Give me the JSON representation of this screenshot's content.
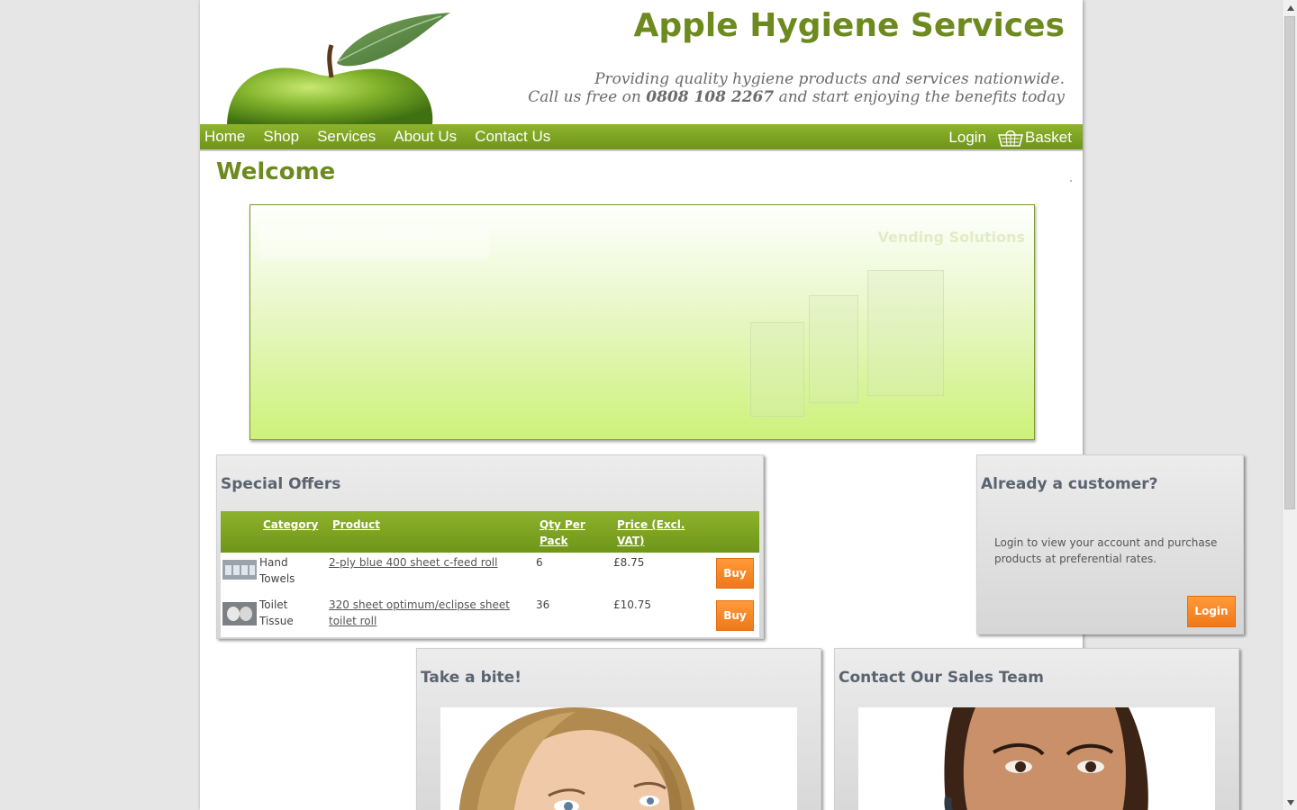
{
  "header": {
    "title": "Apple Hygiene Services",
    "tagline_line1": "Providing quality hygiene products and services nationwide.",
    "tagline_pre": "Call us free on ",
    "phone": "0808 108 2267",
    "tagline_post": " and start enjoying the benefits today"
  },
  "nav": {
    "items": [
      "Home",
      "Shop",
      "Services",
      "About Us",
      "Contact Us"
    ],
    "login": "Login",
    "basket": "Basket"
  },
  "welcome": "Welcome",
  "banner": {
    "heading": "Vending Solutions"
  },
  "offers": {
    "title": "Special Offers",
    "columns": [
      "Category",
      "Product",
      "Qty Per Pack",
      "Price (Excl. VAT)"
    ],
    "rows": [
      {
        "category": "Hand Towels",
        "product": "2-ply blue 400 sheet c-feed roll",
        "qty": "6",
        "price": "£8.75",
        "action": "Buy"
      },
      {
        "category": "Toilet Tissue",
        "product": "320 sheet optimum/eclipse sheet toilet roll",
        "qty": "36",
        "price": "£10.75",
        "action": "Buy"
      }
    ]
  },
  "customer": {
    "title": "Already a customer?",
    "text": "Login to view your account and purchase products at preferential rates.",
    "button": "Login"
  },
  "bite": {
    "title": "Take a bite!"
  },
  "sales": {
    "title": "Contact Our Sales Team"
  },
  "colors": {
    "brand_green": "#6d8a1e",
    "nav_green": "#7fa323",
    "button_orange": "#f7851f"
  }
}
